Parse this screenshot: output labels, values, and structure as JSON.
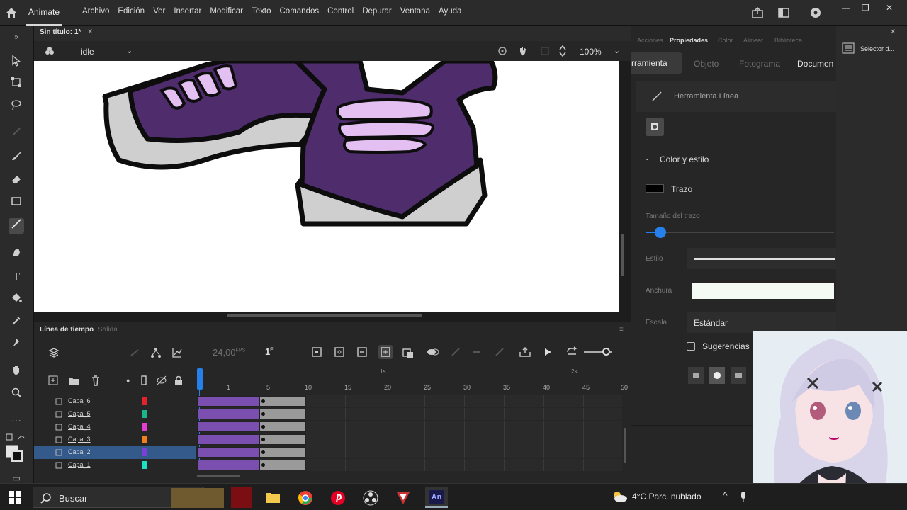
{
  "menubar": {
    "app_name": "Animate",
    "items": [
      "Archivo",
      "Edición",
      "Ver",
      "Insertar",
      "Modificar",
      "Texto",
      "Comandos",
      "Control",
      "Depurar",
      "Ventana",
      "Ayuda"
    ]
  },
  "document": {
    "tab_title": "Sin título: 1*",
    "scene_name": "idle",
    "zoom": "100%"
  },
  "properties_panel": {
    "tabs_top": [
      "Acciones",
      "Propiedades",
      "Color",
      "Alinear",
      "Biblioteca"
    ],
    "active_tab_top": "Propiedades",
    "subtabs": [
      "rramienta",
      "Objeto",
      "Fotograma",
      "Documen"
    ],
    "tool_name": "Herramienta Línea",
    "section_title": "Color y estilo",
    "stroke_label": "Trazo",
    "stroke_color": "#000000",
    "stroke_size_label": "Tamaño del trazo",
    "style_label": "Estilo",
    "width_label": "Anchura",
    "scale_label": "Escala",
    "scale_value": "Estándar",
    "hints_label": "Sugerencias",
    "stroke_size_value": 0.05
  },
  "far_right_panel": {
    "label": "Selector d..."
  },
  "timeline": {
    "tab_label": "Línea de tiempo",
    "tab2_label": "Salida",
    "fps": "24,00",
    "fps_unit": "FPS",
    "current_frame": "1",
    "frame_suffix": "F",
    "ruler": [
      "1",
      "5",
      "10",
      "15",
      "20",
      "25",
      "30",
      "35",
      "40",
      "45",
      "50"
    ],
    "layers": [
      {
        "name": "Capa_6",
        "color": "#e3232b"
      },
      {
        "name": "Capa_5",
        "color": "#1bb58a"
      },
      {
        "name": "Capa_4",
        "color": "#e23fd2"
      },
      {
        "name": "Capa_3",
        "color": "#f07f1d"
      },
      {
        "name": "Capa_2",
        "color": "#7a3fd8",
        "selected": true
      },
      {
        "name": "Capa_1",
        "color": "#1fe0c2"
      }
    ],
    "playhead_marks": [
      "1s",
      "2s"
    ]
  },
  "taskbar": {
    "search_placeholder": "Buscar",
    "weather": "4°C  Parc. nublado"
  },
  "colors": {
    "accent": "#2680eb",
    "shoe_purple": "#4f2d6d",
    "lace_lilac": "#e3bff2",
    "sole_gray": "#cfcfcf"
  }
}
